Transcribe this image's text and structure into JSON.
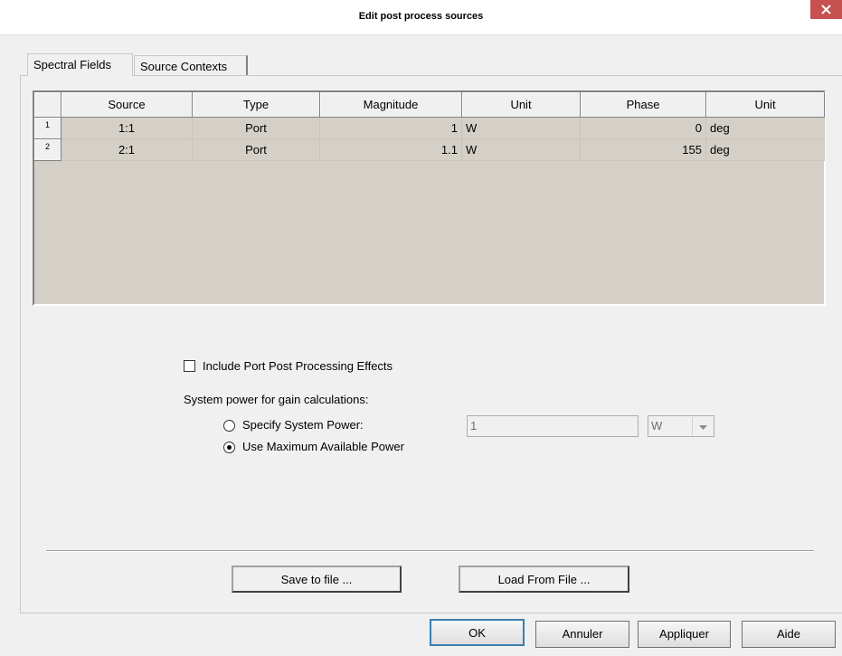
{
  "window": {
    "title": "Edit post process sources"
  },
  "tabs": [
    {
      "label": "Spectral Fields",
      "active": true
    },
    {
      "label": "Source Contexts",
      "active": false
    }
  ],
  "grid": {
    "columns": [
      "Source",
      "Type",
      "Magnitude",
      "Unit",
      "Phase",
      "Unit"
    ],
    "rows": [
      {
        "index": "1",
        "source": "1:1",
        "type": "Port",
        "magnitude": "1",
        "mag_unit": "W",
        "phase": "0",
        "phase_unit": "deg"
      },
      {
        "index": "2",
        "source": "2:1",
        "type": "Port",
        "magnitude": "1.1",
        "mag_unit": "W",
        "phase": "155",
        "phase_unit": "deg"
      }
    ]
  },
  "options": {
    "include_port_effects": {
      "label": "Include Port Post Processing Effects",
      "checked": false
    },
    "system_power_label": "System power for gain calculations:",
    "specify_power": {
      "label": "Specify System Power:",
      "selected": false
    },
    "use_max_power": {
      "label": "Use Maximum Available Power",
      "selected": true
    },
    "power_value": "1",
    "power_unit": "W"
  },
  "buttons": {
    "save_to_file": "Save to file ...",
    "load_from_file": "Load From File ...",
    "ok": "OK",
    "cancel": "Annuler",
    "apply": "Appliquer",
    "help": "Aide"
  },
  "colors": {
    "grid_bg": "#d4d0c8",
    "close_bg": "#c75050"
  }
}
